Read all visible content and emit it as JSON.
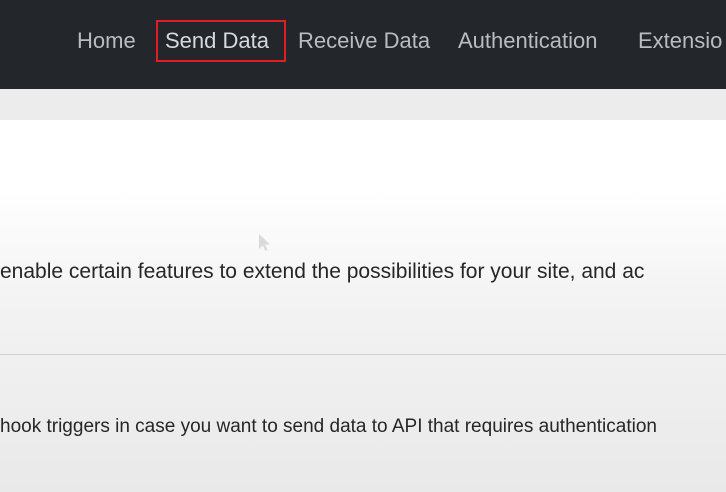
{
  "nav": {
    "items": [
      {
        "label": "Home"
      },
      {
        "label": "Send Data"
      },
      {
        "label": "Receive Data"
      },
      {
        "label": "Authentication"
      },
      {
        "label": "Extensio"
      }
    ]
  },
  "content": {
    "features_text": "enable certain features to extend the possibilities for your site, and ac",
    "webhook_text": "hook triggers in case you want to send data to API that requires authentication"
  }
}
